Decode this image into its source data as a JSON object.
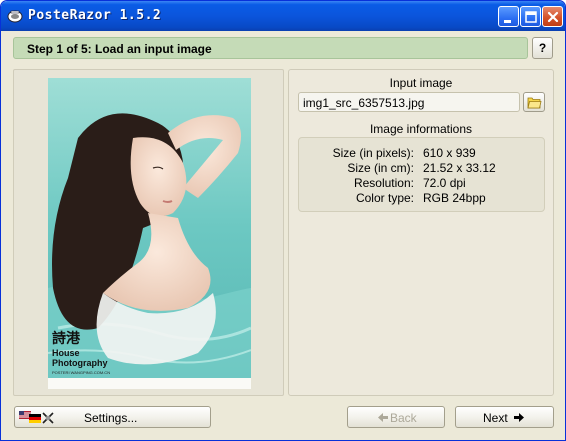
{
  "window": {
    "title": "PosteRazor 1.5.2",
    "controls": {
      "minimize": "minimize-icon",
      "maximize": "maximize-icon",
      "close": "close-icon"
    }
  },
  "step": {
    "label": "Step 1 of 5: Load an input image",
    "help_label": "?",
    "accent_color": "#c5dbb7"
  },
  "preview": {
    "watermark_line1": "House",
    "watermark_line2": "Photography",
    "watermark_small": "POSTERI WANGPING.COM.CN"
  },
  "input_image": {
    "section_title": "Input image",
    "filename": "img1_src_6357513.jpg",
    "open_icon": "folder-open-icon"
  },
  "image_info": {
    "section_title": "Image informations",
    "rows": [
      {
        "key": "Size (in pixels):",
        "value": "610 x 939"
      },
      {
        "key": "Size (in cm):",
        "value": "21.52 x 33.12"
      },
      {
        "key": "Resolution:",
        "value": "72.0 dpi"
      },
      {
        "key": "Color type:",
        "value": "RGB 24bpp"
      }
    ]
  },
  "footer": {
    "settings_label": "Settings...",
    "back_label": "Back",
    "next_label": "Next",
    "back_enabled": false
  }
}
